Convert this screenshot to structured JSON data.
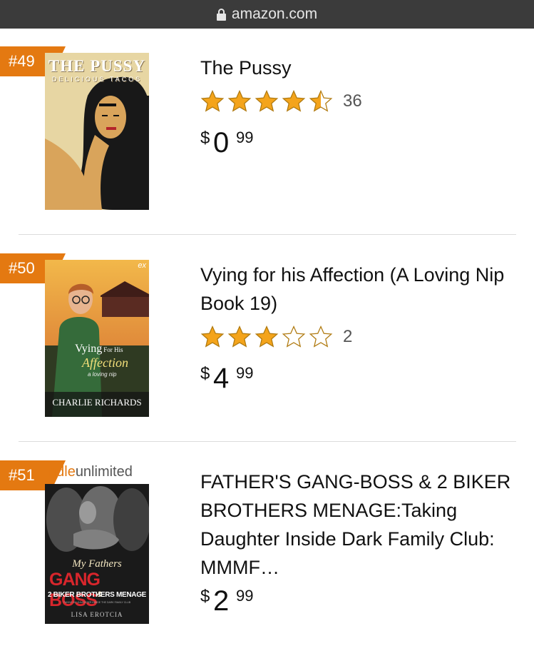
{
  "browser": {
    "url": "amazon.com"
  },
  "colors": {
    "badge": "#e47911",
    "star": "#f4a41b",
    "star_outline": "#b07a10"
  },
  "items": [
    {
      "rank": "#49",
      "title": "The Pussy",
      "rating": 4.5,
      "rating_count": "36",
      "price": {
        "currency": "$",
        "whole": "0",
        "fraction": "99"
      },
      "cover": {
        "title": "THE PUSSY",
        "subtitle": "DELICIOUS TACOS"
      }
    },
    {
      "rank": "#50",
      "title": "Vying for his Affection (A Loving Nip Book 19)",
      "rating": 3,
      "rating_count": "2",
      "price": {
        "currency": "$",
        "whole": "4",
        "fraction": "99"
      },
      "cover": {
        "publisher": "ex",
        "title_main": "Vying",
        "title_small": "For His",
        "title_script": "Affection",
        "series": "a loving nip",
        "author": "CHARLIE RICHARDS"
      }
    },
    {
      "rank": "#51",
      "title": "FATHER'S GANG-BOSS & 2 BIKER BROTHERS MENAGE:Taking Daughter Inside Dark Family Club: MMMF…",
      "price": {
        "currency": "$",
        "whole": "2",
        "fraction": "99"
      },
      "cover": {
        "banner_k": "ndle",
        "banner_u": "unlimited",
        "script": "My Fathers",
        "title": "GANG BOSS",
        "amp": "&",
        "subtitle": "2 BIKER BROTHERS MENAGE",
        "tagline": "TAKING MY DAUGHTER INSIDE THE DARK FAMILY CLUB",
        "author": "LISA EROTCIA"
      }
    }
  ]
}
